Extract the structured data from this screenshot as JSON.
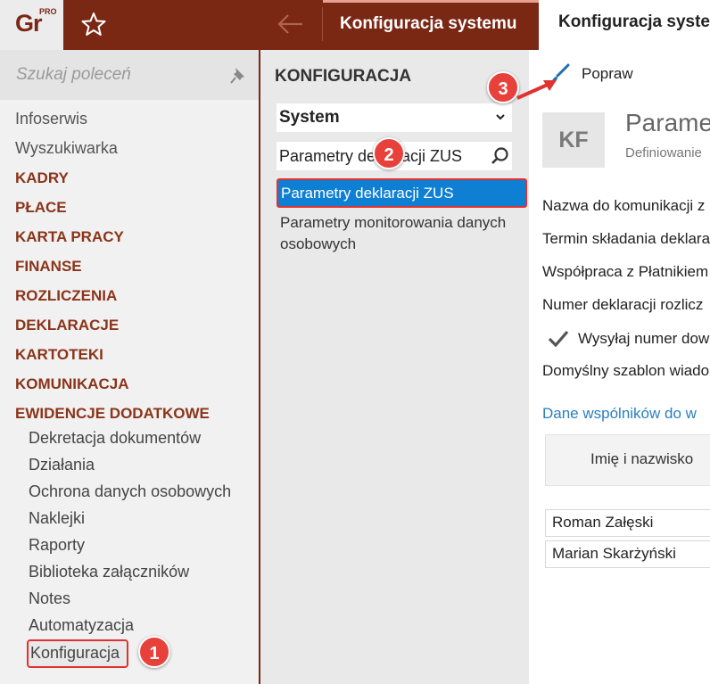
{
  "app": {
    "logo_text": "Gr",
    "logo_sup": "PRO"
  },
  "tabs": [
    {
      "label": "Konfiguracja systemu"
    },
    {
      "label": "Konfiguracja systemu"
    }
  ],
  "sidebar": {
    "search_placeholder": "Szukaj poleceń",
    "items": [
      {
        "label": "Infoserwis"
      },
      {
        "label": "Wyszukiwarka"
      },
      {
        "label": "KADRY"
      },
      {
        "label": "PŁACE"
      },
      {
        "label": "KARTA PRACY"
      },
      {
        "label": "FINANSE"
      },
      {
        "label": "ROZLICZENIA"
      },
      {
        "label": "DEKLARACJE"
      },
      {
        "label": "KARTOTEKI"
      },
      {
        "label": "KOMUNIKACJA"
      },
      {
        "label": "EWIDENCJE DODATKOWE"
      }
    ],
    "subitems": [
      {
        "label": "Dekretacja dokumentów"
      },
      {
        "label": "Działania"
      },
      {
        "label": "Ochrona danych osobowych"
      },
      {
        "label": "Naklejki"
      },
      {
        "label": "Raporty"
      },
      {
        "label": "Biblioteka załączników"
      },
      {
        "label": "Notes"
      },
      {
        "label": "Automatyzacja"
      },
      {
        "label": "Konfiguracja"
      }
    ]
  },
  "middle": {
    "title": "KONFIGURACJA",
    "select_value": "System",
    "search_value": "Parametry deklaracji ZUS",
    "results": [
      {
        "label": "Parametry deklaracji ZUS"
      },
      {
        "label": "Parametry monitorowania danych osobowych"
      }
    ]
  },
  "right": {
    "edit_label": "Popraw",
    "badge": "KF",
    "title": "Paramet",
    "subtitle": "Definiowanie",
    "fields": [
      {
        "label": "Nazwa do komunikacji z"
      },
      {
        "label": "Termin składania deklara"
      },
      {
        "label": "Współpraca z Płatnikiem"
      },
      {
        "label": "Numer deklaracji rozlicz"
      }
    ],
    "checkbox_label": "Wysyłaj numer dow",
    "checkbox_checked": true,
    "template_label": "Domyślny szablon wiado",
    "link": "Dane wspólników do w",
    "table": {
      "header": "Imię i nazwisko",
      "rows": [
        {
          "name": "Roman Załęski"
        },
        {
          "name": "Marian Skarżyński"
        }
      ]
    }
  },
  "callouts": [
    "1",
    "2",
    "3"
  ],
  "colors": {
    "brand": "#7a2714",
    "selected": "#0f7fd4",
    "callout": "#e8403a",
    "link": "#2a7fc0"
  }
}
